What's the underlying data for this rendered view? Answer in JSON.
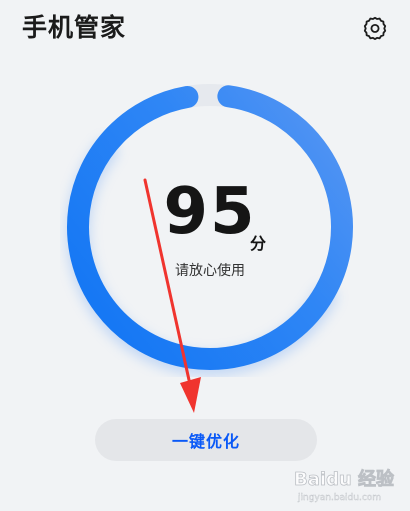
{
  "header": {
    "title": "手机管家",
    "settings_icon": "gear-icon"
  },
  "score_gauge": {
    "score": "95",
    "unit": "分",
    "status": "请放心使用",
    "level_percent": 95,
    "colors": {
      "ring_start": "#1b7cf5",
      "ring_end": "#4a90f3",
      "track": "#e6e9ee"
    }
  },
  "actions": {
    "optimize_label": "一键优化"
  },
  "annotation": {
    "arrow_color": "#f0342e"
  },
  "watermark": {
    "text": "Baidu 经验",
    "url": "jingyan.baidu.com"
  }
}
